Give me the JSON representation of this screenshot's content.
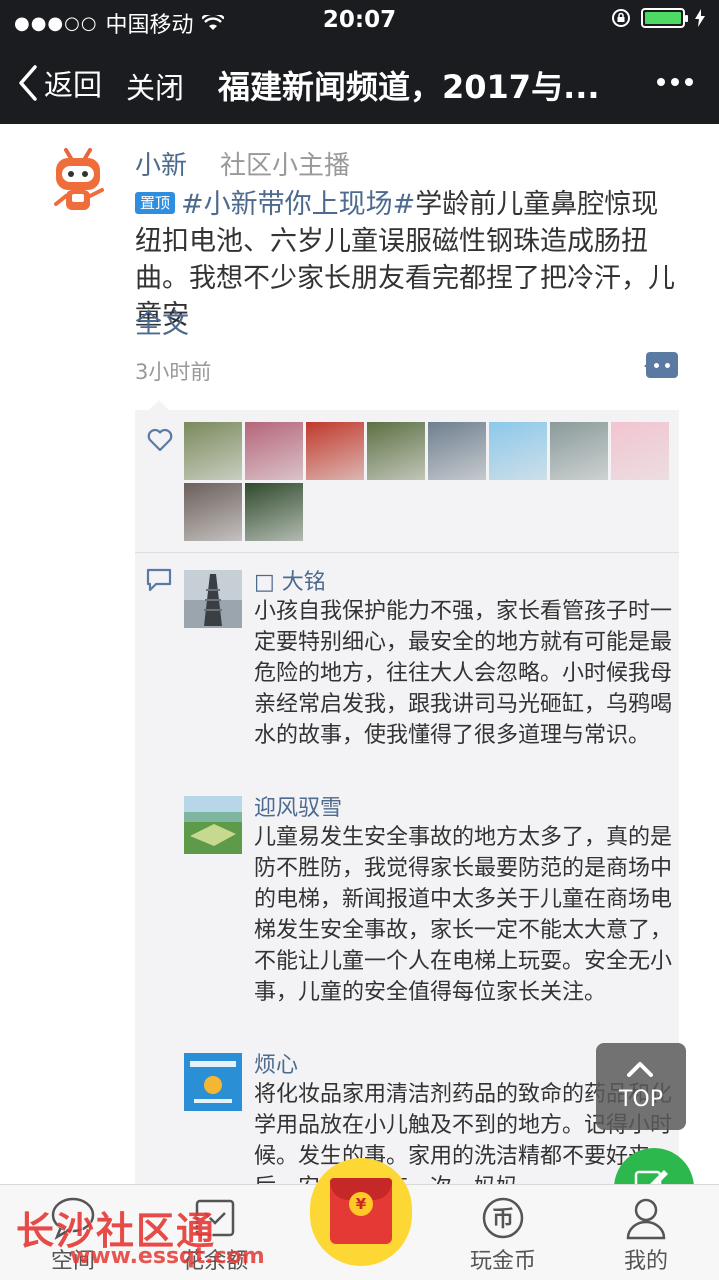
{
  "status_bar": {
    "signal": "●●●○○",
    "carrier": "中国移动",
    "time": "20:07",
    "battery_level": 1.0
  },
  "nav": {
    "back_label": "返回",
    "close_label": "关闭",
    "title": "福建新闻频道，2017与..."
  },
  "post": {
    "username": "小新",
    "user_title": "社区小主播",
    "pin_badge": "置顶",
    "hashtag": "#小新带你上现场#",
    "text": "学龄前儿童鼻腔惊现纽扣电池、六岁儿童误服磁性钢珠造成肠扭曲。我想不少家长朋友看完都捏了把冷汗，儿童安",
    "full_text_link": "全文",
    "time_ago": "3小时前"
  },
  "likes": {
    "thumb_colors": [
      "#7a8a5c",
      "#b5657a",
      "#c0392b",
      "#5d7043",
      "#6f7f8f",
      "#8cc8ea",
      "#8a9a9a",
      "#f2c4d0",
      "#6b5f5a",
      "#2f4a2c"
    ]
  },
  "comments": [
    {
      "name": "□ 大铭",
      "text": "小孩自我保护能力不强，家长看管孩子时一定要特别细心，最安全的地方就有可能是最危险的地方，往往大人会忽略。小时候我母亲经常启发我，跟我讲司马光砸缸，乌鸦喝水的故事，使我懂得了很多道理与常识。"
    },
    {
      "name": "迎风驭雪",
      "text": "儿童易发生安全事故的地方太多了，真的是防不胜防，我觉得家长最要防范的是商场中的电梯，新闻报道中太多关于儿童在商场电梯发生安全事故，家长一定不能太大意了，不能让儿童一个人在电梯上玩耍。安全无小事，儿童的安全值得每位家长关注。"
    },
    {
      "name": "烦心",
      "text": "将化妆品家用清洁剂药品的致命的药品和化学用品放在小儿触及不到的地方。记得小时候。发生的事。家用的洗洁精都不要好来后，安全的。有一次，妈妈"
    }
  ],
  "top_button_label": "TOP",
  "tabs": [
    {
      "label": "空间"
    },
    {
      "label": "花余额"
    },
    {
      "label": "玩金币"
    },
    {
      "label": "我的"
    }
  ],
  "red_packet_symbol": "¥",
  "watermark": {
    "name": "长沙社区通",
    "url": "www.essqt.com"
  }
}
